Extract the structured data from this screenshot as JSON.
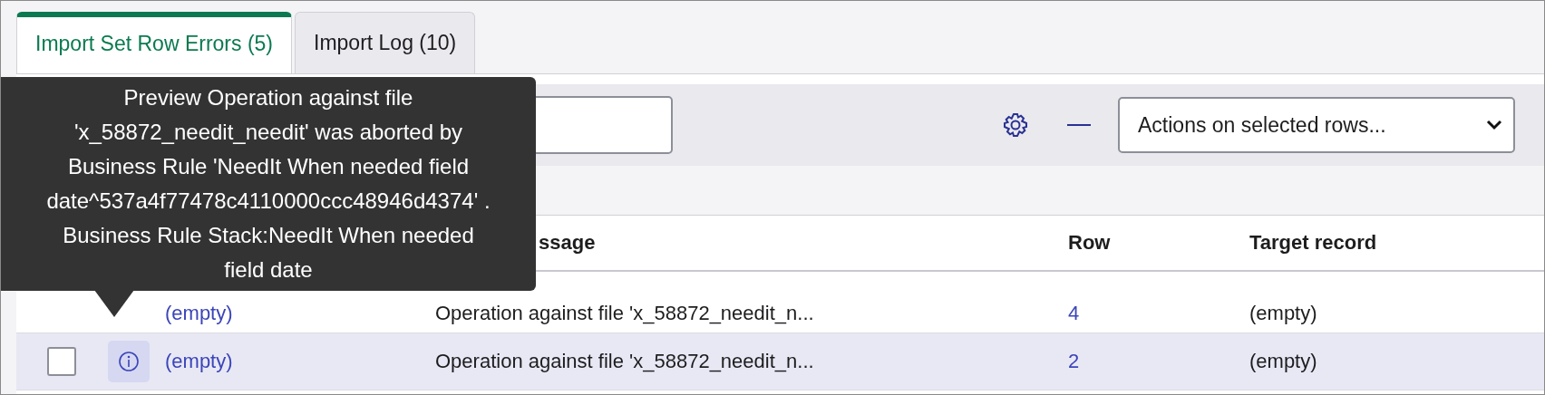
{
  "tabs": [
    {
      "label": "Import Set Row Errors (5)",
      "selected": true
    },
    {
      "label": "Import Log (10)",
      "selected": false
    }
  ],
  "toolbar": {
    "actions_select": "Actions on selected rows..."
  },
  "table": {
    "columns": [
      "",
      "ssage",
      "Row",
      "Target record"
    ],
    "rows": [
      {
        "hovered": false,
        "selected": false,
        "cells": [
          "(empty)",
          "Operation against file 'x_58872_needit_n...",
          "4",
          "(empty)"
        ]
      },
      {
        "hovered": true,
        "checked": false,
        "selected": true,
        "cells": [
          "(empty)",
          "Operation against file 'x_58872_needit_n...",
          "2",
          "(empty)"
        ]
      }
    ]
  },
  "tooltip": "Preview Operation against file 'x_58872_needit_needit' was aborted by Business Rule 'NeedIt When needed field date^537a4f77478c4110000ccc48946d4374' . Business Rule Stack:NeedIt When needed field date"
}
